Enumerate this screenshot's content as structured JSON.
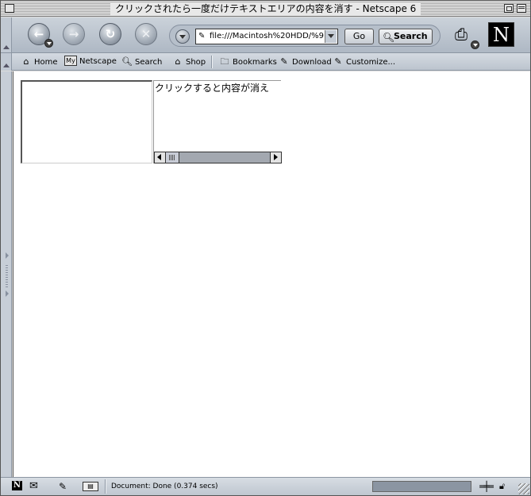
{
  "window": {
    "title": "クリックされたら一度だけテキストエリアの内容を消す - Netscape 6"
  },
  "navbar": {
    "back_icon": "back-arrow-icon",
    "forward_icon": "forward-arrow-icon",
    "reload_icon": "reload-icon",
    "stop_icon": "stop-icon",
    "url_value": "file:///Macintosh%20HDD/%9",
    "go_label": "Go",
    "search_label": "Search"
  },
  "personal_toolbar": {
    "items": [
      {
        "label": "Home",
        "icon": "home-icon"
      },
      {
        "label": "Netscape",
        "icon": "my-netscape-icon"
      },
      {
        "label": "Search",
        "icon": "search-icon"
      },
      {
        "label": "Shop",
        "icon": "shop-icon"
      },
      {
        "label": "Bookmarks",
        "icon": "folder-icon"
      },
      {
        "label": "Download",
        "icon": "link-icon"
      },
      {
        "label": "Customize...",
        "icon": "link-icon"
      }
    ],
    "my_badge": "My"
  },
  "content": {
    "textarea_value": "クリックすると内容が消え"
  },
  "statusbar": {
    "text": "Document: Done (0.374 secs)",
    "logo_letter": "N",
    "address_badge": "▤"
  },
  "colors": {
    "toolbar": "#b6bfca",
    "progress": "#8b95a2"
  }
}
